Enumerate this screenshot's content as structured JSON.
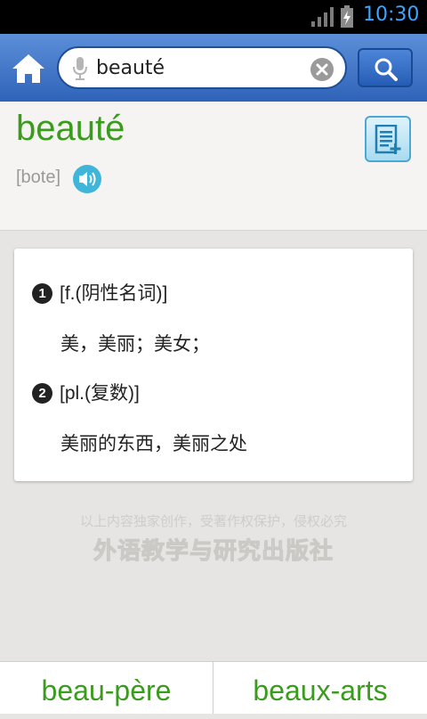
{
  "status_bar": {
    "time": "10:30",
    "icons": [
      "signal-icon",
      "battery-charging-icon"
    ]
  },
  "search": {
    "query": "beauté",
    "icons": [
      "home-icon",
      "mic-icon",
      "clear-icon",
      "search-icon"
    ]
  },
  "entry": {
    "headword": "beauté",
    "phonetic": "[bote]",
    "icons": [
      "speaker-icon",
      "add-note-icon"
    ]
  },
  "definitions": [
    {
      "number": "1",
      "pos": "[f.(阴性名词)]",
      "meaning": "美，美丽；美女；"
    },
    {
      "number": "2",
      "pos": "[pl.(复数)]",
      "meaning": "美丽的东西，美丽之处"
    }
  ],
  "copyright": {
    "notice": "以上内容独家创作，受著作权保护，侵权必究",
    "publisher": "外语教学与研究出版社"
  },
  "nav": {
    "previous": "beau-père",
    "next": "beaux-arts"
  },
  "colors": {
    "headword": "#3a9c1c",
    "header": "#2f63b8",
    "time": "#3aa6ff"
  }
}
